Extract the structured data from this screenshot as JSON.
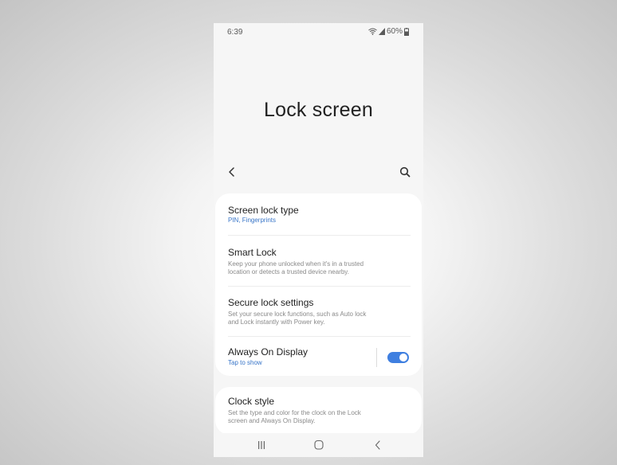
{
  "status_bar": {
    "time": "6:39",
    "battery": "60%",
    "wifi_icon": "wifi-icon",
    "signal_icon": "signal-icon",
    "battery_icon": "battery-icon"
  },
  "page": {
    "title": "Lock screen",
    "back_icon": "chevron-left-icon",
    "search_icon": "search-icon"
  },
  "settings": {
    "screen_lock_type": {
      "title": "Screen lock type",
      "subtitle": "PIN, Fingerprints"
    },
    "smart_lock": {
      "title": "Smart Lock",
      "subtitle_line1": "Keep your phone unlocked when it's in a trusted",
      "subtitle_line2": "location or detects a trusted device nearby."
    },
    "secure_lock_settings": {
      "title": "Secure lock settings",
      "subtitle_line1": "Set your secure lock functions, such as Auto lock",
      "subtitle_line2": "and Lock instantly with Power key."
    },
    "always_on_display": {
      "title": "Always On Display",
      "subtitle": "Tap to show",
      "enabled": true
    },
    "clock_style": {
      "title": "Clock style",
      "subtitle_line1": "Set the type and color for the clock on the Lock",
      "subtitle_line2": "screen and Always On Display."
    }
  },
  "navbar": {
    "recents_icon": "recents-icon",
    "home_icon": "home-icon",
    "back_icon": "back-icon"
  },
  "colors": {
    "accent": "#3f7fe0",
    "link_blue": "#3875c8",
    "background": "#f6f6f6",
    "card": "#ffffff"
  }
}
